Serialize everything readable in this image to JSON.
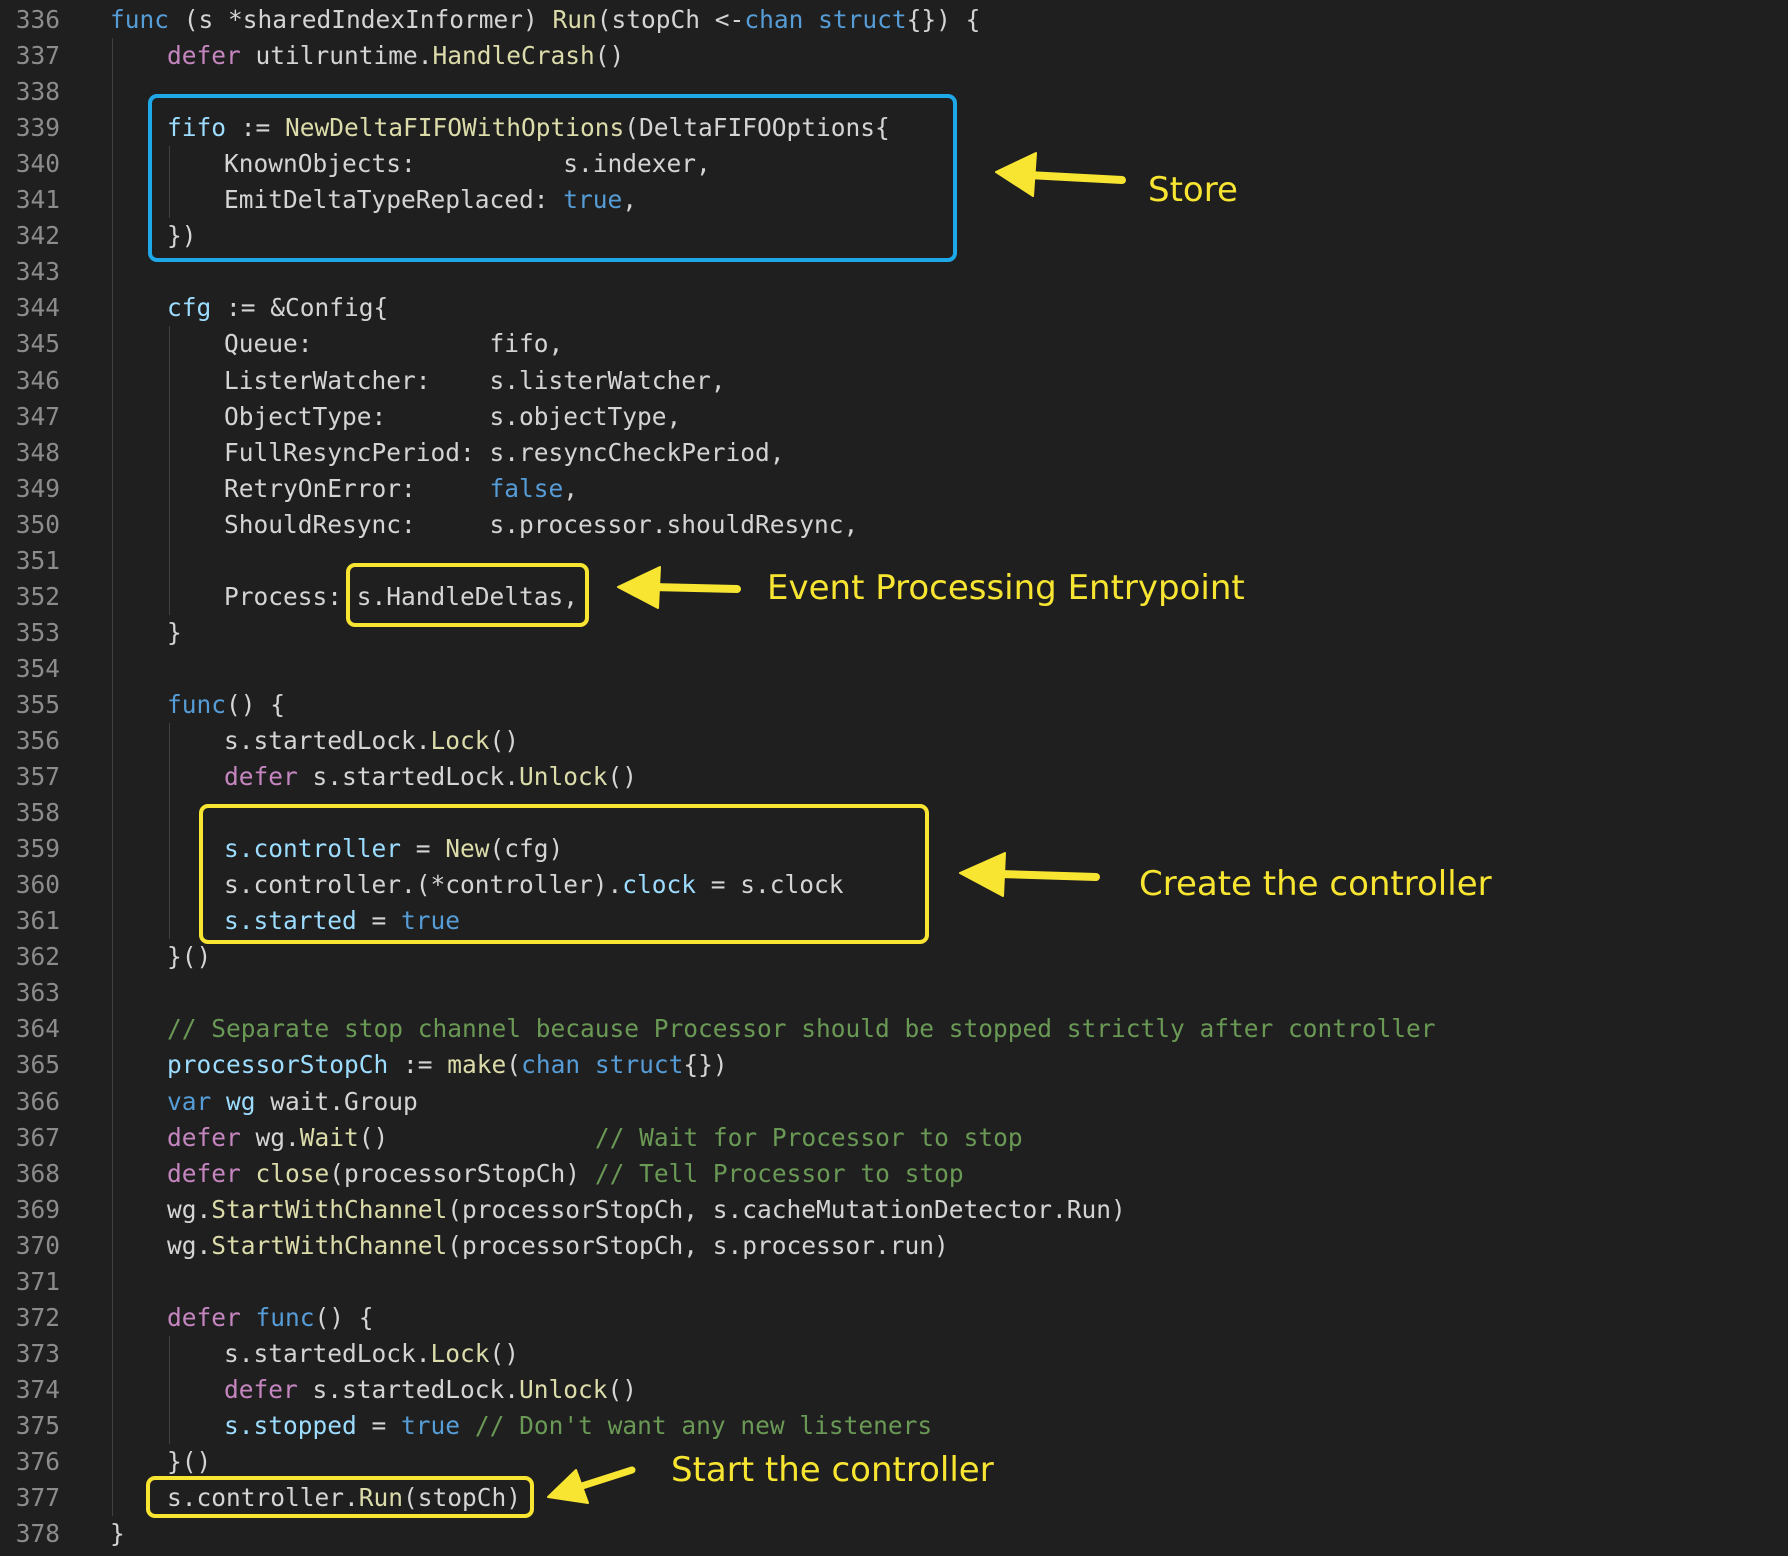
{
  "colors": {
    "background": "#1f1f1f",
    "line_number": "#8c8c8c",
    "text": "#d4d4d4",
    "keyword": "#569cd6",
    "control": "#c586c0",
    "function": "#dcdcaa",
    "variable": "#9cdcfe",
    "comment": "#6a9955",
    "annotation_yellow": "#f7e532",
    "annotation_blue": "#1fa8e8"
  },
  "code": {
    "lines": [
      {
        "n": "336",
        "indent": 0,
        "tokens": [
          [
            "kw",
            "func"
          ],
          [
            "txt",
            " (s *sharedIndexInformer) "
          ],
          [
            "fn",
            "Run"
          ],
          [
            "txt",
            "(stopCh <-"
          ],
          [
            "kw",
            "chan"
          ],
          [
            "txt",
            " "
          ],
          [
            "kw",
            "struct"
          ],
          [
            "txt",
            "{}) {"
          ]
        ]
      },
      {
        "n": "337",
        "indent": 1,
        "tokens": [
          [
            "ctl",
            "defer"
          ],
          [
            "txt",
            " utilruntime."
          ],
          [
            "fn",
            "HandleCrash"
          ],
          [
            "txt",
            "()"
          ]
        ]
      },
      {
        "n": "338",
        "indent": 1,
        "tokens": []
      },
      {
        "n": "339",
        "indent": 1,
        "tokens": [
          [
            "var",
            "fifo"
          ],
          [
            "txt",
            " := "
          ],
          [
            "fn",
            "NewDeltaFIFOWithOptions"
          ],
          [
            "txt",
            "(DeltaFIFOOptions{"
          ]
        ]
      },
      {
        "n": "340",
        "indent": 2,
        "tokens": [
          [
            "txt",
            "KnownObjects:          s.indexer,"
          ]
        ]
      },
      {
        "n": "341",
        "indent": 2,
        "tokens": [
          [
            "txt",
            "EmitDeltaTypeReplaced: "
          ],
          [
            "kw",
            "true"
          ],
          [
            "txt",
            ","
          ]
        ]
      },
      {
        "n": "342",
        "indent": 1,
        "tokens": [
          [
            "txt",
            "})"
          ]
        ]
      },
      {
        "n": "343",
        "indent": 1,
        "tokens": []
      },
      {
        "n": "344",
        "indent": 1,
        "tokens": [
          [
            "var",
            "cfg"
          ],
          [
            "txt",
            " := &Config{"
          ]
        ]
      },
      {
        "n": "345",
        "indent": 2,
        "tokens": [
          [
            "txt",
            "Queue:            fifo,"
          ]
        ]
      },
      {
        "n": "346",
        "indent": 2,
        "tokens": [
          [
            "txt",
            "ListerWatcher:    s.listerWatcher,"
          ]
        ]
      },
      {
        "n": "347",
        "indent": 2,
        "tokens": [
          [
            "txt",
            "ObjectType:       s.objectType,"
          ]
        ]
      },
      {
        "n": "348",
        "indent": 2,
        "tokens": [
          [
            "txt",
            "FullResyncPeriod: s.resyncCheckPeriod,"
          ]
        ]
      },
      {
        "n": "349",
        "indent": 2,
        "tokens": [
          [
            "txt",
            "RetryOnError:     "
          ],
          [
            "kw",
            "false"
          ],
          [
            "txt",
            ","
          ]
        ]
      },
      {
        "n": "350",
        "indent": 2,
        "tokens": [
          [
            "txt",
            "ShouldResync:     s.processor.shouldResync,"
          ]
        ]
      },
      {
        "n": "351",
        "indent": 2,
        "tokens": []
      },
      {
        "n": "352",
        "indent": 2,
        "tokens": [
          [
            "txt",
            "Process: s.HandleDeltas,"
          ]
        ]
      },
      {
        "n": "353",
        "indent": 1,
        "tokens": [
          [
            "txt",
            "}"
          ]
        ]
      },
      {
        "n": "354",
        "indent": 1,
        "tokens": []
      },
      {
        "n": "355",
        "indent": 1,
        "tokens": [
          [
            "kw",
            "func"
          ],
          [
            "txt",
            "() {"
          ]
        ]
      },
      {
        "n": "356",
        "indent": 2,
        "tokens": [
          [
            "txt",
            "s.startedLock."
          ],
          [
            "fn",
            "Lock"
          ],
          [
            "txt",
            "()"
          ]
        ]
      },
      {
        "n": "357",
        "indent": 2,
        "tokens": [
          [
            "ctl",
            "defer"
          ],
          [
            "txt",
            " s.startedLock."
          ],
          [
            "fn",
            "Unlock"
          ],
          [
            "txt",
            "()"
          ]
        ]
      },
      {
        "n": "358",
        "indent": 2,
        "tokens": []
      },
      {
        "n": "359",
        "indent": 2,
        "tokens": [
          [
            "var",
            "s.controller"
          ],
          [
            "txt",
            " = "
          ],
          [
            "fn",
            "New"
          ],
          [
            "txt",
            "(cfg)"
          ]
        ]
      },
      {
        "n": "360",
        "indent": 2,
        "tokens": [
          [
            "txt",
            "s.controller.(*controller)."
          ],
          [
            "var",
            "clock"
          ],
          [
            "txt",
            " = s.clock"
          ]
        ]
      },
      {
        "n": "361",
        "indent": 2,
        "tokens": [
          [
            "var",
            "s.started"
          ],
          [
            "txt",
            " = "
          ],
          [
            "kw",
            "true"
          ]
        ]
      },
      {
        "n": "362",
        "indent": 1,
        "tokens": [
          [
            "txt",
            "}()"
          ]
        ]
      },
      {
        "n": "363",
        "indent": 1,
        "tokens": []
      },
      {
        "n": "364",
        "indent": 1,
        "tokens": [
          [
            "cm",
            "// Separate stop channel because Processor should be stopped strictly after controller"
          ]
        ]
      },
      {
        "n": "365",
        "indent": 1,
        "tokens": [
          [
            "var",
            "processorStopCh"
          ],
          [
            "txt",
            " := "
          ],
          [
            "fn",
            "make"
          ],
          [
            "txt",
            "("
          ],
          [
            "kw",
            "chan"
          ],
          [
            "txt",
            " "
          ],
          [
            "kw",
            "struct"
          ],
          [
            "txt",
            "{})"
          ]
        ]
      },
      {
        "n": "366",
        "indent": 1,
        "tokens": [
          [
            "kw",
            "var"
          ],
          [
            "txt",
            " "
          ],
          [
            "var",
            "wg"
          ],
          [
            "txt",
            " wait.Group"
          ]
        ]
      },
      {
        "n": "367",
        "indent": 1,
        "tokens": [
          [
            "ctl",
            "defer"
          ],
          [
            "txt",
            " wg."
          ],
          [
            "fn",
            "Wait"
          ],
          [
            "txt",
            "()              "
          ],
          [
            "cm",
            "// Wait for Processor to stop"
          ]
        ]
      },
      {
        "n": "368",
        "indent": 1,
        "tokens": [
          [
            "ctl",
            "defer"
          ],
          [
            "txt",
            " "
          ],
          [
            "fn",
            "close"
          ],
          [
            "txt",
            "(processorStopCh) "
          ],
          [
            "cm",
            "// Tell Processor to stop"
          ]
        ]
      },
      {
        "n": "369",
        "indent": 1,
        "tokens": [
          [
            "txt",
            "wg."
          ],
          [
            "fn",
            "StartWithChannel"
          ],
          [
            "txt",
            "(processorStopCh, s.cacheMutationDetector.Run)"
          ]
        ]
      },
      {
        "n": "370",
        "indent": 1,
        "tokens": [
          [
            "txt",
            "wg."
          ],
          [
            "fn",
            "StartWithChannel"
          ],
          [
            "txt",
            "(processorStopCh, s.processor.run)"
          ]
        ]
      },
      {
        "n": "371",
        "indent": 1,
        "tokens": []
      },
      {
        "n": "372",
        "indent": 1,
        "tokens": [
          [
            "ctl",
            "defer"
          ],
          [
            "txt",
            " "
          ],
          [
            "kw",
            "func"
          ],
          [
            "txt",
            "() {"
          ]
        ]
      },
      {
        "n": "373",
        "indent": 2,
        "tokens": [
          [
            "txt",
            "s.startedLock."
          ],
          [
            "fn",
            "Lock"
          ],
          [
            "txt",
            "()"
          ]
        ]
      },
      {
        "n": "374",
        "indent": 2,
        "tokens": [
          [
            "ctl",
            "defer"
          ],
          [
            "txt",
            " s.startedLock."
          ],
          [
            "fn",
            "Unlock"
          ],
          [
            "txt",
            "()"
          ]
        ]
      },
      {
        "n": "375",
        "indent": 2,
        "tokens": [
          [
            "var",
            "s.stopped"
          ],
          [
            "txt",
            " = "
          ],
          [
            "kw",
            "true"
          ],
          [
            "txt",
            " "
          ],
          [
            "cm",
            "// Don't want any new listeners"
          ]
        ]
      },
      {
        "n": "376",
        "indent": 1,
        "tokens": [
          [
            "txt",
            "}()"
          ]
        ]
      },
      {
        "n": "377",
        "indent": 1,
        "tokens": [
          [
            "txt",
            "s.controller."
          ],
          [
            "fn",
            "Run"
          ],
          [
            "txt",
            "(stopCh)"
          ]
        ]
      },
      {
        "n": "378",
        "indent": 0,
        "tokens": [
          [
            "txt",
            "}"
          ]
        ]
      }
    ]
  },
  "annotations": {
    "store": "Store",
    "entrypoint": "Event Processing Entrypoint",
    "create_controller": "Create the controller",
    "start_controller": "Start the controller"
  }
}
